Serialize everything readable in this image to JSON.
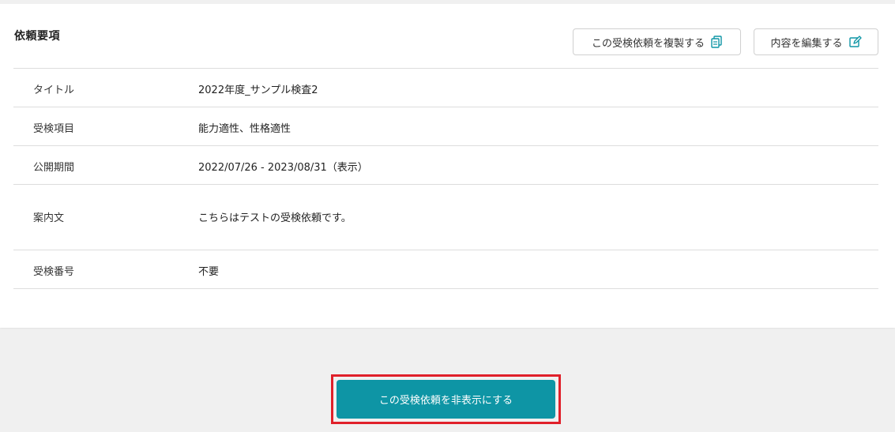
{
  "section": {
    "title": "依頼要項"
  },
  "actions": {
    "copy_label": "この受検依頼を複製する",
    "copy_icon": "copy-icon",
    "edit_label": "内容を編集する",
    "edit_icon": "edit-icon",
    "accent_color": "#0e95a5"
  },
  "details": [
    {
      "label": "タイトル",
      "value": "2022年度_サンプル検査2"
    },
    {
      "label": "受検項目",
      "value": "能力適性、性格適性"
    },
    {
      "label": "公開期間",
      "value": "2022/07/26 - 2023/08/31（表示）"
    },
    {
      "label": "案内文",
      "value": "こちらはテストの受検依頼です。"
    },
    {
      "label": "受検番号",
      "value": "不要"
    }
  ],
  "footer": {
    "hide_label": "この受検依頼を非表示にする",
    "hide_color": "#0e95a5",
    "highlight_color": "#e0202a"
  }
}
